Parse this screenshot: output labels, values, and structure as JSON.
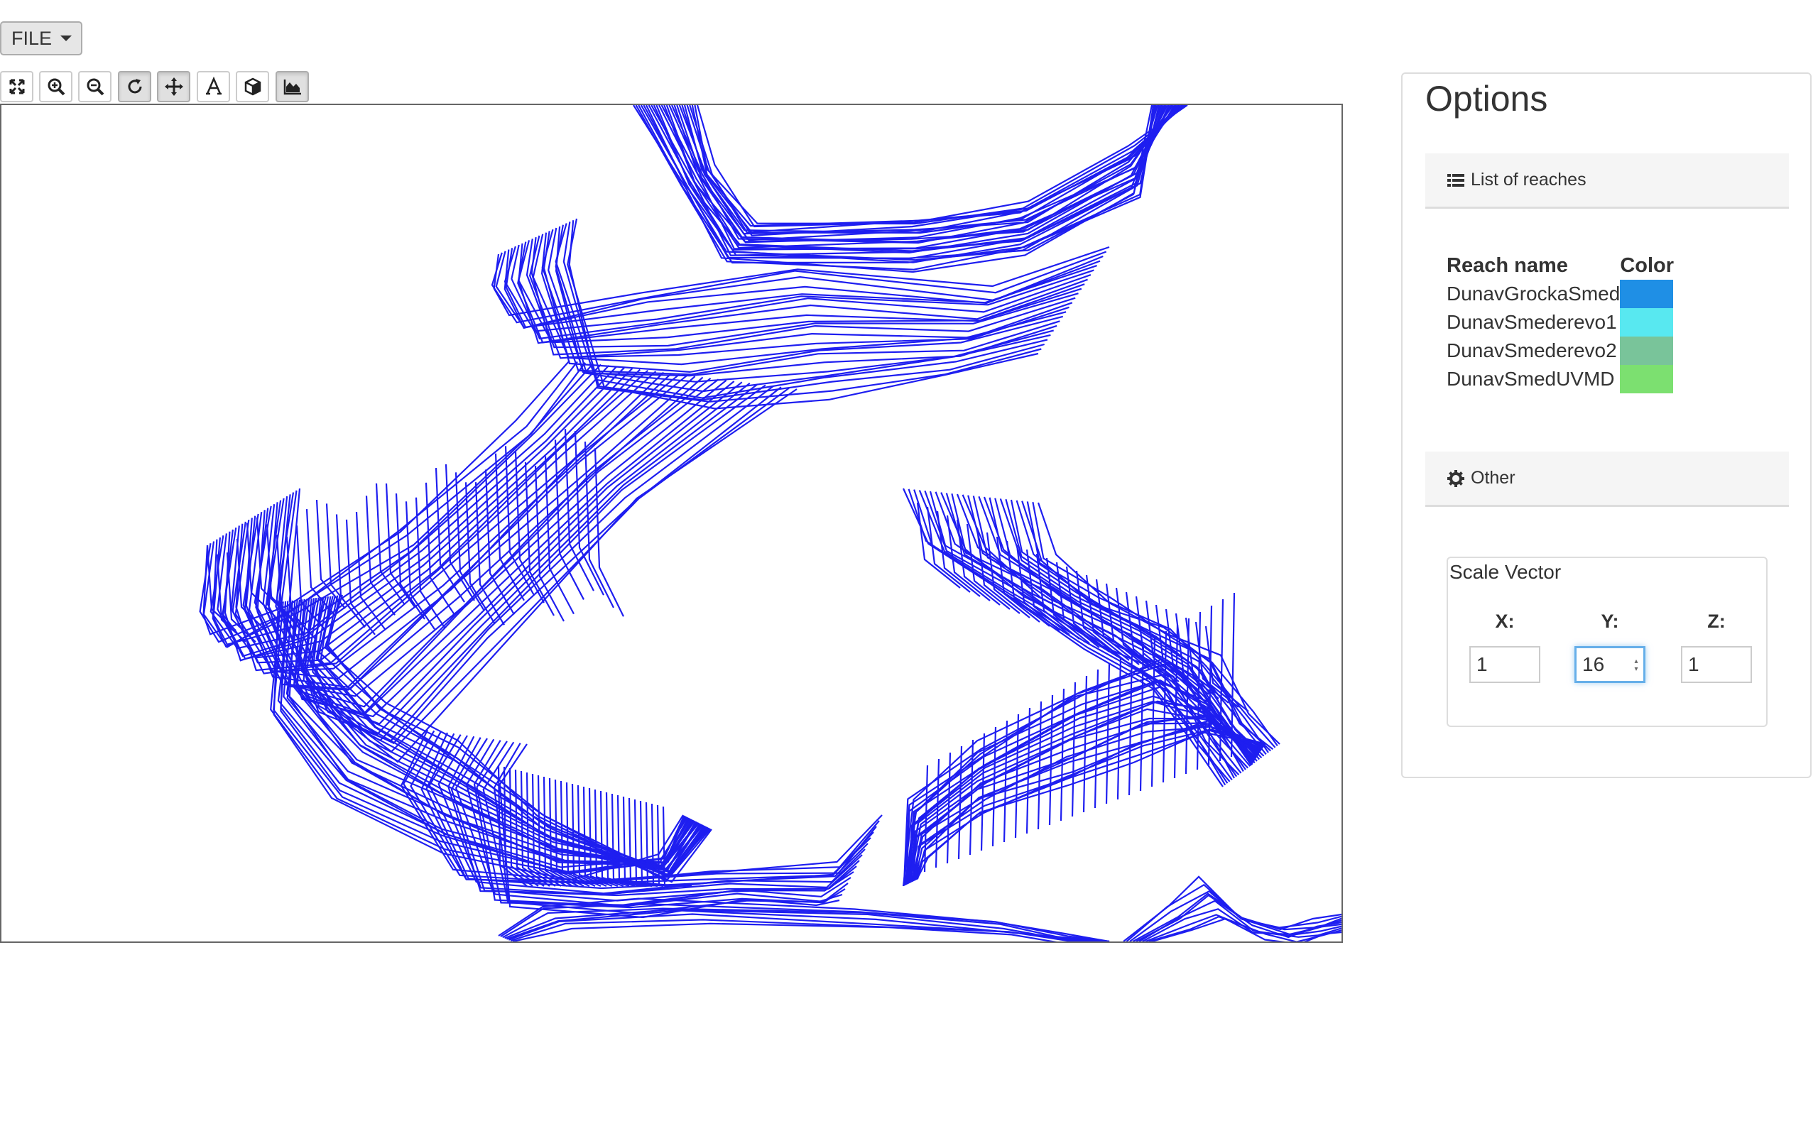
{
  "menu": {
    "file_label": "FILE"
  },
  "toolbar": {
    "tools": [
      {
        "icon": "fullscreen-icon",
        "active": false
      },
      {
        "icon": "zoom-in-icon",
        "active": false
      },
      {
        "icon": "zoom-out-icon",
        "active": false
      },
      {
        "icon": "rotate-icon",
        "active": true
      },
      {
        "icon": "pan-move-icon",
        "active": true
      },
      {
        "icon": "text-label-icon",
        "active": false
      },
      {
        "icon": "cube-3d-icon",
        "active": false
      },
      {
        "icon": "area-chart-icon",
        "active": true
      }
    ]
  },
  "viewer": {
    "line_color": "#1e1ef0"
  },
  "options": {
    "title": "Options",
    "reaches_section": {
      "icon": "list-icon",
      "label": "List of reaches"
    },
    "reach_table": {
      "col_name": "Reach name",
      "col_color": "Color",
      "rows": [
        {
          "name": "DunavGrockaSmed",
          "color": "#1f8fe5"
        },
        {
          "name": "DunavSmederevo1",
          "color": "#58e8f0"
        },
        {
          "name": "DunavSmederevo2",
          "color": "#79c49a"
        },
        {
          "name": "DunavSmedUVMD",
          "color": "#7ce070"
        }
      ]
    },
    "other_section": {
      "icon": "gear-icon",
      "label": "Other"
    },
    "scale_vector": {
      "legend": "Scale Vector",
      "x_label": "X:",
      "x_value": "1",
      "y_label": "Y:",
      "y_value": "16",
      "z_label": "Z:",
      "z_value": "1"
    }
  }
}
